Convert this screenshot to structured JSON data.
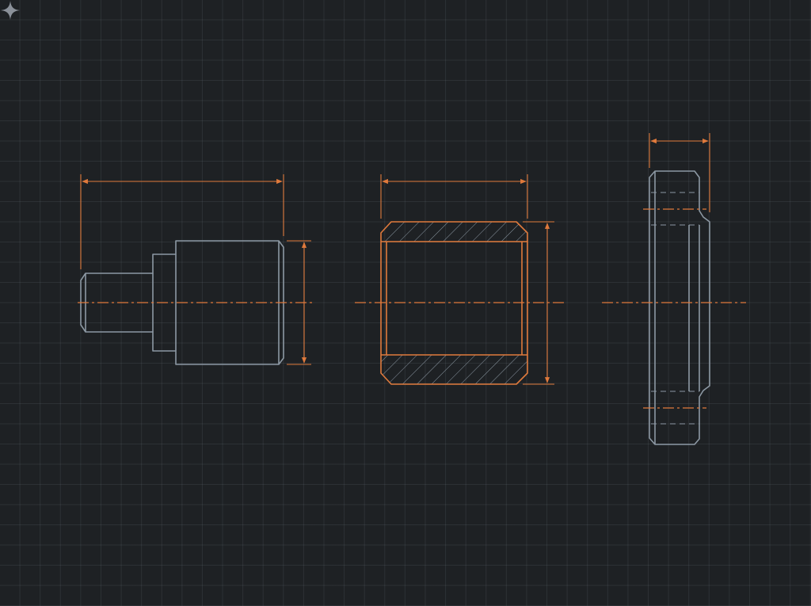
{
  "colors": {
    "background": "#1e2124",
    "grid": "#2b3036",
    "outline": "#8c98a3",
    "accent": "#e07a3c"
  },
  "views": [
    {
      "id": "stepped-shaft",
      "outline_color": "outline"
    },
    {
      "id": "sleeve-section",
      "outline_color": "accent"
    },
    {
      "id": "flange-side",
      "outline_color": "outline"
    }
  ],
  "watermark": {
    "icon": "sparkle-icon"
  }
}
